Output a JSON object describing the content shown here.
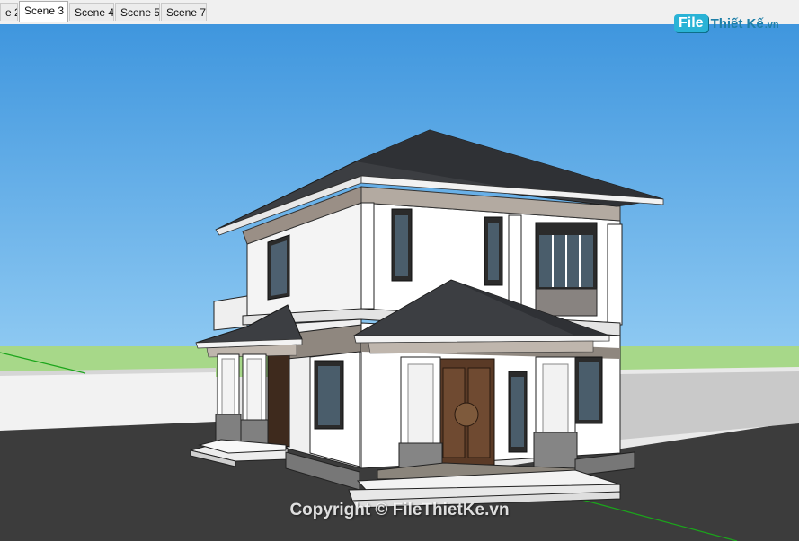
{
  "tabs": [
    {
      "label": "e 2"
    },
    {
      "label": "Scene 3"
    },
    {
      "label": "Scene 4"
    },
    {
      "label": "Scene 5"
    },
    {
      "label": "Scene 7"
    }
  ],
  "active_tab": "Scene 3",
  "logo": {
    "box": "File",
    "text": "Thiết Kế",
    "domain": ".vn"
  },
  "watermark": "Copyright © FileThietKe.vn",
  "colors": {
    "sky": "#4aa0e2",
    "grass": "#a8d88a",
    "ground": "#3d3d3d",
    "roof": "#3b3d40",
    "wall": "#ffffff",
    "accent_wall": "#8f877f",
    "door": "#5a3a26"
  }
}
